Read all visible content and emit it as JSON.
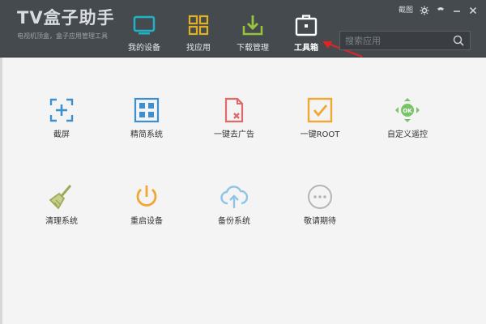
{
  "app": {
    "name": "TV盒子助手",
    "tagline": "电视机顶盒，盒子应用管理工具"
  },
  "window_controls": {
    "screenshot": "截图"
  },
  "nav": [
    {
      "label": "我的设备",
      "icon": "monitor-icon",
      "color": "#1fb3c8"
    },
    {
      "label": "找应用",
      "icon": "grid-icon",
      "color": "#e3b021"
    },
    {
      "label": "下载管理",
      "icon": "download-icon",
      "color": "#9bc43d"
    },
    {
      "label": "工具箱",
      "icon": "toolbox-icon",
      "color": "#ffffff",
      "active": true
    }
  ],
  "search": {
    "placeholder": "搜索应用"
  },
  "tools": [
    {
      "label": "截屏",
      "icon": "screenshot-icon",
      "color": "#3d8fd0"
    },
    {
      "label": "精简系统",
      "icon": "streamline-icon",
      "color": "#3d8fd0"
    },
    {
      "label": "一键去广告",
      "icon": "remove-ads-icon",
      "color": "#e06a6a"
    },
    {
      "label": "一键ROOT",
      "icon": "root-icon",
      "color": "#f0a733"
    },
    {
      "label": "自定义遥控",
      "icon": "remote-icon",
      "color": "#7ac36a"
    },
    {
      "label": "清理系统",
      "icon": "broom-icon",
      "color": "#9bab57"
    },
    {
      "label": "重启设备",
      "icon": "power-icon",
      "color": "#f0a733"
    },
    {
      "label": "备份系统",
      "icon": "cloud-upload-icon",
      "color": "#8fc3e8"
    },
    {
      "label": "敬请期待",
      "icon": "more-icon",
      "color": "#b5b5b5"
    }
  ]
}
